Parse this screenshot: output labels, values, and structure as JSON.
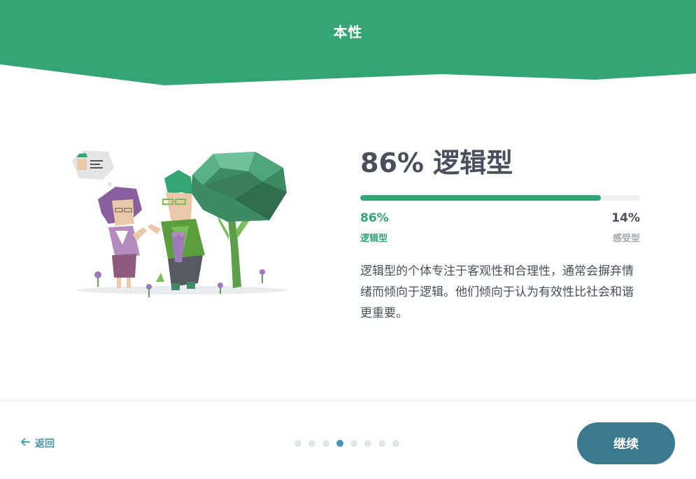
{
  "header": {
    "title": "本性",
    "color": "#33a474"
  },
  "result": {
    "headline": "86% 逻辑型",
    "progress_fraction": 0.86,
    "left": {
      "percent": "86%",
      "label": "逻辑型"
    },
    "right": {
      "percent": "14%",
      "label": "感受型"
    },
    "description": "逻辑型的个体专注于客观性和合理性，通常会摒弃情绪而倾向于逻辑。他们倾向于认为有效性比社会和谐更重要。"
  },
  "footer": {
    "back_label": "返回",
    "continue_label": "继续",
    "dots_total": 8,
    "dots_active_index": 3
  },
  "colors": {
    "accent": "#33a474",
    "secondary": "#4298b4",
    "button": "#397a90"
  },
  "icons": [
    "arrow-left-icon"
  ]
}
